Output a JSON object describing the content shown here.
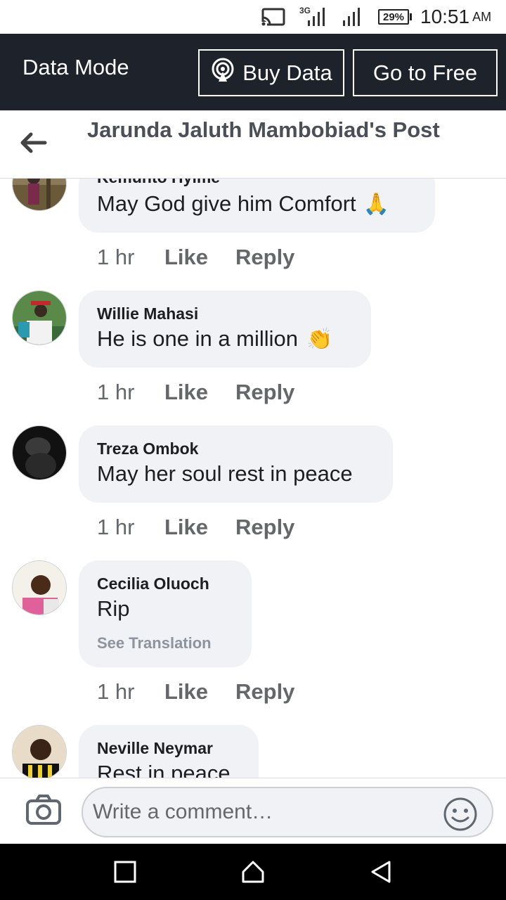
{
  "status_bar": {
    "network_label": "3G",
    "battery": "29%",
    "time": "10:51",
    "ampm": "AM",
    "icons": [
      "cast-icon",
      "signal-3g-icon",
      "signal-icon",
      "battery-icon"
    ]
  },
  "data_banner": {
    "title": "Data Mode",
    "buy_data": "Buy Data",
    "go_free": "Go to Free"
  },
  "header": {
    "title": "Jarunda Jaluth Mambobiad's Post"
  },
  "comments": [
    {
      "name": "Kemunto Hylme",
      "text": "May God give him Comfort",
      "emoji": "🙏",
      "time": "1 hr",
      "like": "Like",
      "reply": "Reply"
    },
    {
      "name": "Willie Mahasi",
      "text": "He is one in a million",
      "emoji": "👏",
      "time": "1 hr",
      "like": "Like",
      "reply": "Reply"
    },
    {
      "name": "Treza Ombok",
      "text": "May her soul rest in peace",
      "time": "1 hr",
      "like": "Like",
      "reply": "Reply"
    },
    {
      "name": "Cecilia Oluoch",
      "text": "Rip",
      "translation": "See Translation",
      "time": "1 hr",
      "like": "Like",
      "reply": "Reply"
    },
    {
      "name": "Neville Neymar",
      "text": "Rest in peace"
    }
  ],
  "composer": {
    "placeholder": "Write a comment…"
  },
  "colors": {
    "banner_bg": "#1e232b",
    "bubble_bg": "#f0f2f5",
    "title_gray": "#4b4f56",
    "meta_gray": "#65676b"
  }
}
